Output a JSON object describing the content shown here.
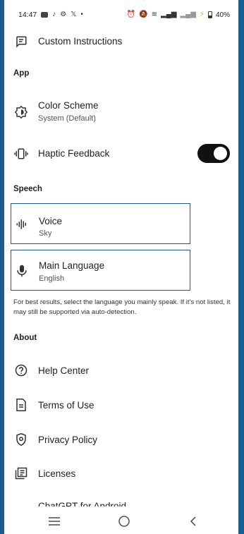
{
  "status_bar": {
    "time": "14:47",
    "battery": "40%"
  },
  "settings": {
    "custom_instructions": "Custom Instructions",
    "app_section": "App",
    "color_scheme": {
      "label": "Color Scheme",
      "value": "System (Default)"
    },
    "haptic_feedback": {
      "label": "Haptic Feedback",
      "enabled": true
    },
    "speech_section": "Speech",
    "voice": {
      "label": "Voice",
      "value": "Sky"
    },
    "main_language": {
      "label": "Main Language",
      "value": "English"
    },
    "language_note": "For best results, select the language you mainly speak. If it's not listed, it may still be supported via auto-detection.",
    "about_section": "About",
    "help_center": "Help Center",
    "terms_of_use": "Terms of Use",
    "privacy_policy": "Privacy Policy",
    "licenses": "Licenses",
    "app_version": "ChatGPT for Android"
  },
  "colors": {
    "accent": "#1b5e8c",
    "toggle_on": "#111111"
  }
}
